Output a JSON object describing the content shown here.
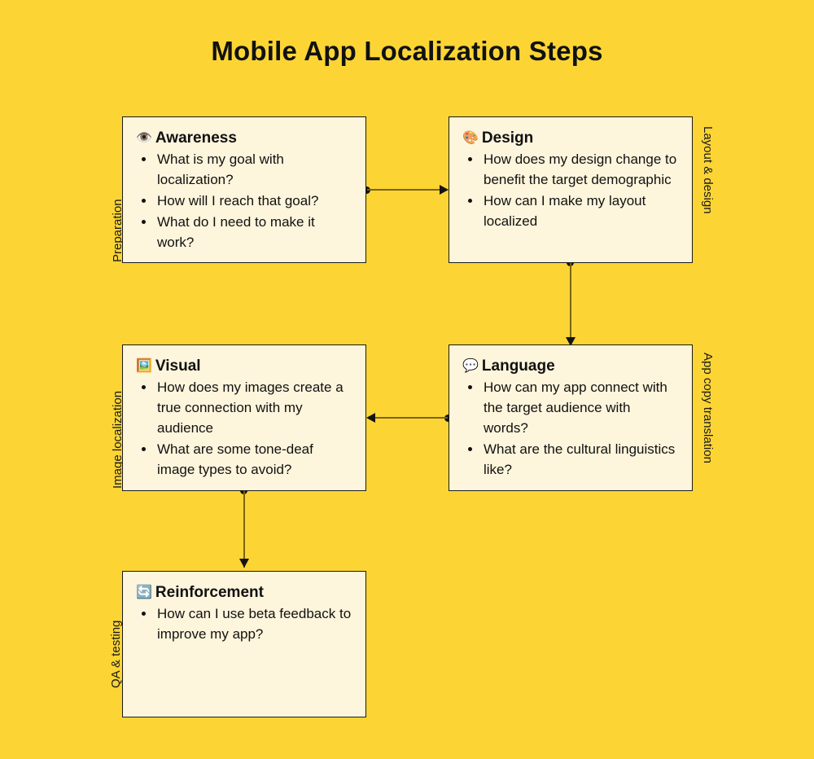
{
  "page": {
    "title": "Mobile App Localization Steps",
    "background_color": "#fcd535",
    "node_fill_color": "#fdf5dc",
    "node_border_color": "#1a1a1a",
    "connector_color": "#7a6410"
  },
  "nodes": [
    {
      "id": "awareness",
      "emoji": "👁️",
      "emoji_name": "eye-icon",
      "title": "Awareness",
      "items": [
        "What is my goal with localization?",
        "How will I reach that goal?",
        "What do I need to make it work?"
      ]
    },
    {
      "id": "design",
      "emoji": "🎨",
      "emoji_name": "artist-palette-icon",
      "title": "Design",
      "items": [
        "How does my design change to benefit the target demographic",
        "How can I make my layout localized"
      ]
    },
    {
      "id": "visual",
      "emoji": "🖼️",
      "emoji_name": "framed-picture-icon",
      "title": "Visual",
      "items": [
        "How does my images create a true connection with my audience",
        "What are some tone-deaf image types to avoid?"
      ]
    },
    {
      "id": "language",
      "emoji": "💬",
      "emoji_name": "speech-balloon-icon",
      "title": "Language",
      "items": [
        "How can my app connect with the target audience with words?",
        "What are the cultural linguistics like?"
      ]
    },
    {
      "id": "reinforcement",
      "emoji": "🔄",
      "emoji_name": "counterclockwise-arrows-icon",
      "title": "Reinforcement",
      "items": [
        "How can I use beta feedback to improve my app?"
      ]
    }
  ],
  "lane_labels": {
    "preparation": "Preparation",
    "layout_design": "Layout & design",
    "image_localization": "Image localization",
    "app_copy_translation": "App copy translation",
    "qa_testing": "QA & testing"
  }
}
